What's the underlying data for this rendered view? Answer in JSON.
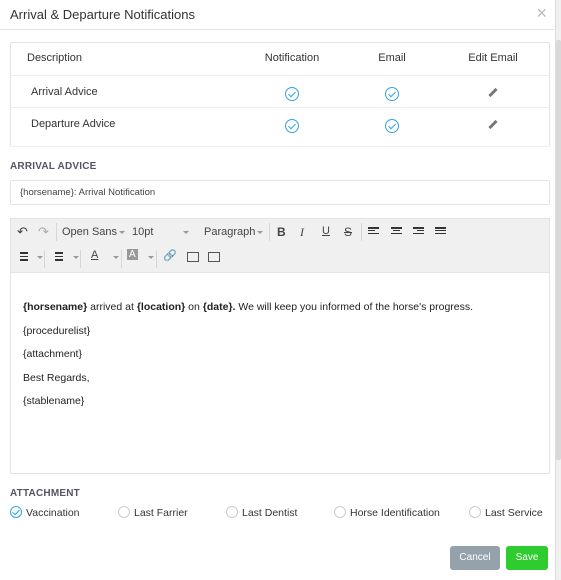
{
  "dialog": {
    "title": "Arrival & Departure Notifications",
    "close_symbol": "×"
  },
  "table": {
    "headers": [
      "Description",
      "Notification",
      "Email",
      "Edit Email"
    ],
    "rows": [
      {
        "description": "Arrival Advice",
        "notification": true,
        "email": true
      },
      {
        "description": "Departure Advice",
        "notification": true,
        "email": true
      }
    ]
  },
  "arrival_advice": {
    "label": "ARRIVAL ADVICE",
    "subject_value": "{horsename}: Arrival Notification"
  },
  "editor": {
    "font_family": "Open Sans",
    "font_size": "10pt",
    "block_format": "Paragraph",
    "toolbar_icons": [
      "undo-icon",
      "redo-icon",
      "bold-icon",
      "italic-icon",
      "underline-icon",
      "strikethrough-icon",
      "align-left-icon",
      "align-center-icon",
      "align-right-icon",
      "align-justify-icon",
      "bullet-list-icon",
      "numbered-list-icon",
      "text-color-icon",
      "background-color-icon",
      "link-icon",
      "image-icon",
      "media-icon"
    ],
    "bold_glyph": "B",
    "italic_glyph": "I",
    "underline_glyph": "U",
    "strike_glyph": "S",
    "text_color_glyph": "A",
    "bg_color_glyph": "A",
    "line1": {
      "v1": "{horsename}",
      "t1": " arrived at ",
      "v2": "{location}",
      "t2": " on ",
      "v3": "{date}.",
      "t3": " We will keep you informed of the horse's progress."
    },
    "line2": "{procedurelist}",
    "line3": "{attachment}",
    "line4": "Best Regards,",
    "line5": "{stablename}"
  },
  "attachment": {
    "label": "ATTACHMENT",
    "options": [
      {
        "label": "Vaccination",
        "checked": true
      },
      {
        "label": "Last Farrier",
        "checked": false
      },
      {
        "label": "Last Dentist",
        "checked": false
      },
      {
        "label": "Horse Identification",
        "checked": false
      },
      {
        "label": "Last Service",
        "checked": false
      }
    ]
  },
  "buttons": {
    "cancel": "Cancel",
    "save": "Save"
  },
  "colors": {
    "accent_blue": "#2fa4e7",
    "save_green": "#2ecc2e",
    "cancel_gray": "#95a2ab"
  }
}
